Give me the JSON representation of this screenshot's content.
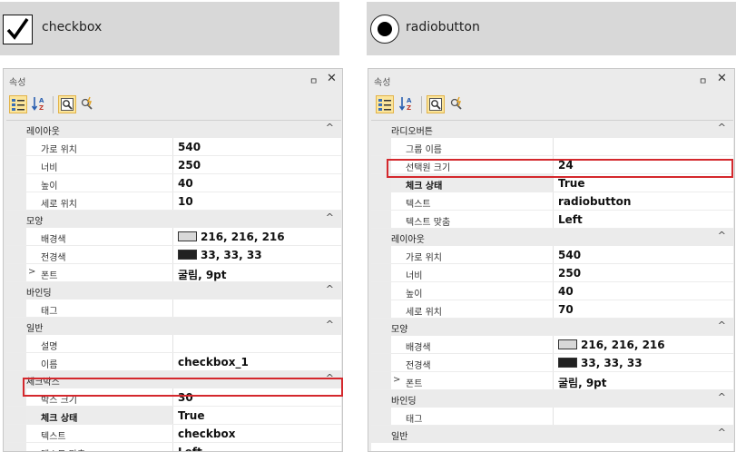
{
  "checkbox_preview": {
    "label": "checkbox"
  },
  "radio_preview": {
    "label": "radiobutton"
  },
  "colors": {
    "highlight": "#d4282d",
    "toolbar_active": "#fbe59b",
    "back_swatch": "#d8d8d8",
    "fore_swatch": "#212121"
  },
  "left_panel": {
    "title": "속성",
    "pin": "ㅁ",
    "close": "✕",
    "categories": [
      {
        "label": "레이아웃",
        "rows": [
          {
            "name": "가로 위치",
            "value": "540"
          },
          {
            "name": "너비",
            "value": "250"
          },
          {
            "name": "높이",
            "value": "40"
          },
          {
            "name": "세로 위치",
            "value": "10"
          }
        ]
      },
      {
        "label": "모양",
        "rows": [
          {
            "name": "배경색",
            "value": "216, 216, 216"
          },
          {
            "name": "전경색",
            "value": "33, 33, 33"
          },
          {
            "name": "폰트",
            "value": "굴림, 9pt"
          }
        ]
      },
      {
        "label": "바인딩",
        "rows": [
          {
            "name": "태그",
            "value": ""
          }
        ]
      },
      {
        "label": "일반",
        "rows": [
          {
            "name": "설명",
            "value": ""
          },
          {
            "name": "이름",
            "value": "checkbox_1"
          }
        ]
      },
      {
        "label": "체크박스",
        "rows": [
          {
            "name": "박스 크기",
            "value": "30"
          },
          {
            "name": "체크 상태",
            "value": "True"
          },
          {
            "name": "텍스트",
            "value": "checkbox"
          },
          {
            "name": "텍스트 맞춤",
            "value": "Left"
          }
        ]
      }
    ]
  },
  "right_panel": {
    "title": "속성",
    "pin": "ㅁ",
    "close": "✕",
    "categories": [
      {
        "label": "라디오버튼",
        "rows": [
          {
            "name": "그룹 이름",
            "value": ""
          },
          {
            "name": "선택원 크기",
            "value": "24"
          },
          {
            "name": "체크 상태",
            "value": "True"
          },
          {
            "name": "텍스트",
            "value": "radiobutton"
          },
          {
            "name": "텍스트 맞춤",
            "value": "Left"
          }
        ]
      },
      {
        "label": "레이아웃",
        "rows": [
          {
            "name": "가로 위치",
            "value": "540"
          },
          {
            "name": "너비",
            "value": "250"
          },
          {
            "name": "높이",
            "value": "40"
          },
          {
            "name": "세로 위치",
            "value": "70"
          }
        ]
      },
      {
        "label": "모양",
        "rows": [
          {
            "name": "배경색",
            "value": "216, 216, 216"
          },
          {
            "name": "전경색",
            "value": "33, 33, 33"
          },
          {
            "name": "폰트",
            "value": "굴림, 9pt"
          }
        ]
      },
      {
        "label": "바인딩",
        "rows": [
          {
            "name": "태그",
            "value": ""
          }
        ]
      },
      {
        "label": "일반",
        "rows": []
      }
    ]
  },
  "collapse_glyph": "^",
  "expand_glyph": ">"
}
